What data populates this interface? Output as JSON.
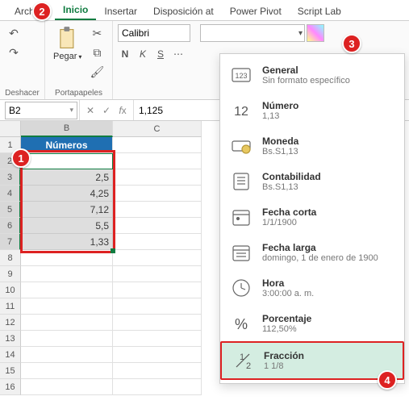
{
  "tabs": [
    "Archivo",
    "Inicio",
    "Insertar",
    "Disposición at",
    "Power Pivot",
    "Script Lab"
  ],
  "activeTab": 1,
  "ribbon": {
    "undo_label": "Deshacer",
    "clipboard_label": "Portapapeles",
    "paste_label": "Pegar",
    "font_name": "Calibri",
    "font_buttons": [
      "N",
      "K",
      "S"
    ]
  },
  "namebox": "B2",
  "formula": "1,125",
  "columns": [
    "B",
    "C"
  ],
  "rows_header": "Números",
  "data": [
    "1,125",
    "2,5",
    "4,25",
    "7,12",
    "5,5",
    "1,33"
  ],
  "row_count": 16,
  "dropdown": [
    {
      "title": "General",
      "sub": "Sin formato específico",
      "icon": "general"
    },
    {
      "title": "Número",
      "sub": "1,13",
      "icon": "number"
    },
    {
      "title": "Moneda",
      "sub": "Bs.S1,13",
      "icon": "currency"
    },
    {
      "title": "Contabilidad",
      "sub": "Bs.S1,13",
      "icon": "accounting"
    },
    {
      "title": "Fecha corta",
      "sub": "1/1/1900",
      "icon": "dateshort"
    },
    {
      "title": "Fecha larga",
      "sub": "domingo, 1 de enero de 1900",
      "icon": "datelong"
    },
    {
      "title": "Hora",
      "sub": "3:00:00 a. m.",
      "icon": "time"
    },
    {
      "title": "Porcentaje",
      "sub": "112,50%",
      "icon": "percent"
    },
    {
      "title": "Fracción",
      "sub": "1 1/8",
      "icon": "fraction"
    }
  ],
  "highlighted": 8,
  "badges": {
    "1": "1",
    "2": "2",
    "3": "3",
    "4": "4"
  }
}
